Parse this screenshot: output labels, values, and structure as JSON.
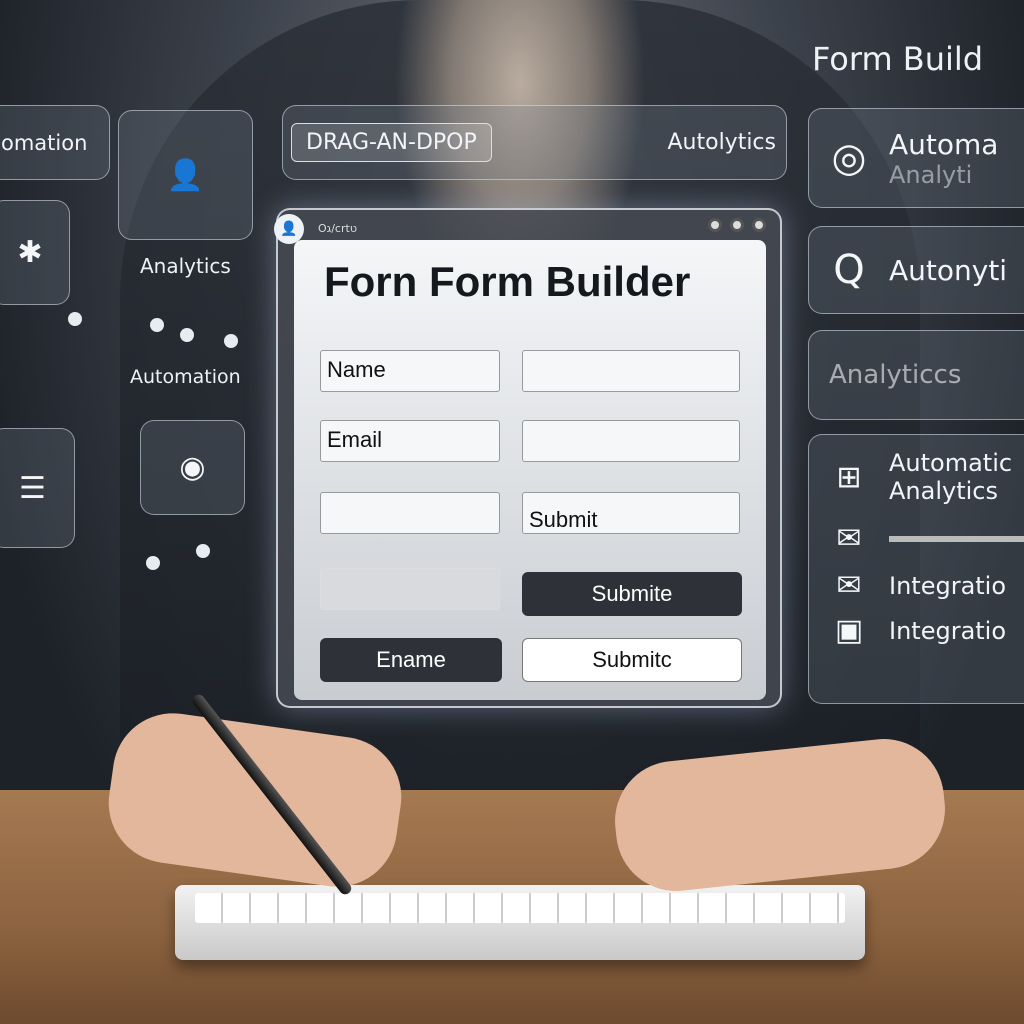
{
  "top_right": {
    "title": "Form Build"
  },
  "top_bar": {
    "drag_label": "DRAG-AN-DPOP",
    "autolytics": "Autolytics"
  },
  "left": {
    "automation_top": "omation",
    "analytics": "Analytics",
    "automation": "Automation"
  },
  "window": {
    "bar_text": "Oג/crtט",
    "title": "Forn Form Builder",
    "fields": [
      {
        "label": "Name"
      },
      {
        "label": "Email"
      },
      {
        "label": ""
      }
    ],
    "submit_field_text": "Submit",
    "buttons": {
      "submite": "Submite",
      "ename": "Ename",
      "submitc": "Submitc"
    }
  },
  "right": {
    "items": [
      {
        "icon": "dial-icon",
        "label": "Automa",
        "sub": "Analyti"
      },
      {
        "icon": "search-icon",
        "label": "Autonyti"
      },
      {
        "label": "Analyticcs"
      },
      {
        "icon": "calendar-icon",
        "label": "Automatic",
        "sub": "Analytics"
      },
      {
        "icon": "mail-icon",
        "label": ""
      },
      {
        "icon": "mail-icon",
        "label": "Integratio"
      },
      {
        "icon": "image-icon",
        "label": "Integratio"
      }
    ]
  }
}
